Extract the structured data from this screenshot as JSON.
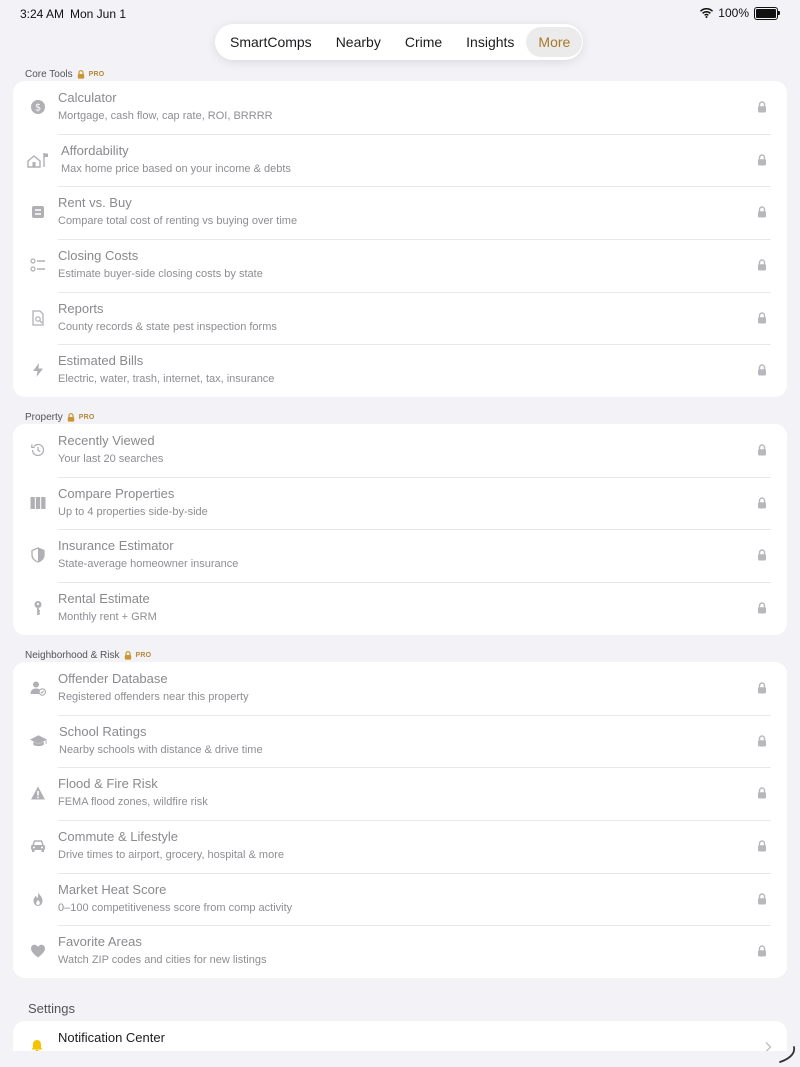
{
  "status": {
    "time": "3:24 AM",
    "date": "Mon Jun 1",
    "battery": "100%"
  },
  "tabs": [
    {
      "label": "SmartComps"
    },
    {
      "label": "Nearby"
    },
    {
      "label": "Crime"
    },
    {
      "label": "Insights"
    },
    {
      "label": "More"
    }
  ],
  "active_tab": "More",
  "pro_badge": "PRO",
  "sections": [
    {
      "title": "Core Tools",
      "items": [
        {
          "title": "Calculator",
          "subtitle": "Mortgage, cash flow, cap rate, ROI, BRRRR",
          "icon": "dollar-icon"
        },
        {
          "title": "Affordability",
          "subtitle": "Max home price based on your income & debts",
          "icon": "house-flag-icon"
        },
        {
          "title": "Rent vs. Buy",
          "subtitle": "Compare total cost of renting vs buying over time",
          "icon": "compare-icon"
        },
        {
          "title": "Closing Costs",
          "subtitle": "Estimate buyer-side closing costs by state",
          "icon": "checklist-icon"
        },
        {
          "title": "Reports",
          "subtitle": "County records & state pest inspection forms",
          "icon": "document-search-icon"
        },
        {
          "title": "Estimated Bills",
          "subtitle": "Electric, water, trash, internet, tax, insurance",
          "icon": "bolt-icon"
        }
      ]
    },
    {
      "title": "Property",
      "items": [
        {
          "title": "Recently Viewed",
          "subtitle": "Your last 20 searches",
          "icon": "history-icon"
        },
        {
          "title": "Compare Properties",
          "subtitle": "Up to 4 properties side-by-side",
          "icon": "columns-icon"
        },
        {
          "title": "Insurance Estimator",
          "subtitle": "State-average homeowner insurance",
          "icon": "shield-icon"
        },
        {
          "title": "Rental Estimate",
          "subtitle": "Monthly rent + GRM",
          "icon": "key-icon"
        }
      ]
    },
    {
      "title": "Neighborhood & Risk",
      "items": [
        {
          "title": "Offender Database",
          "subtitle": "Registered offenders near this property",
          "icon": "person-check-icon"
        },
        {
          "title": "School Ratings",
          "subtitle": "Nearby schools with distance & drive time",
          "icon": "graduation-cap-icon"
        },
        {
          "title": "Flood & Fire Risk",
          "subtitle": "FEMA flood zones, wildfire risk",
          "icon": "warning-icon"
        },
        {
          "title": "Commute & Lifestyle",
          "subtitle": "Drive times to airport, grocery, hospital & more",
          "icon": "car-icon"
        },
        {
          "title": "Market Heat Score",
          "subtitle": "0–100 competitiveness score from comp activity",
          "icon": "flame-icon"
        },
        {
          "title": "Favorite Areas",
          "subtitle": "Watch ZIP codes and cities for new listings",
          "icon": "heart-icon"
        }
      ]
    }
  ],
  "settings": {
    "title": "Settings",
    "items": [
      {
        "title": "Notification Center",
        "icon": "bell-icon"
      }
    ]
  },
  "colors": {
    "accent": "#a8782a",
    "pro": "#b58a3a",
    "background": "#f2f2f7",
    "muted_text": "#8e8e93",
    "icon_gray": "#b0b0b4",
    "bell": "#f5c400"
  }
}
